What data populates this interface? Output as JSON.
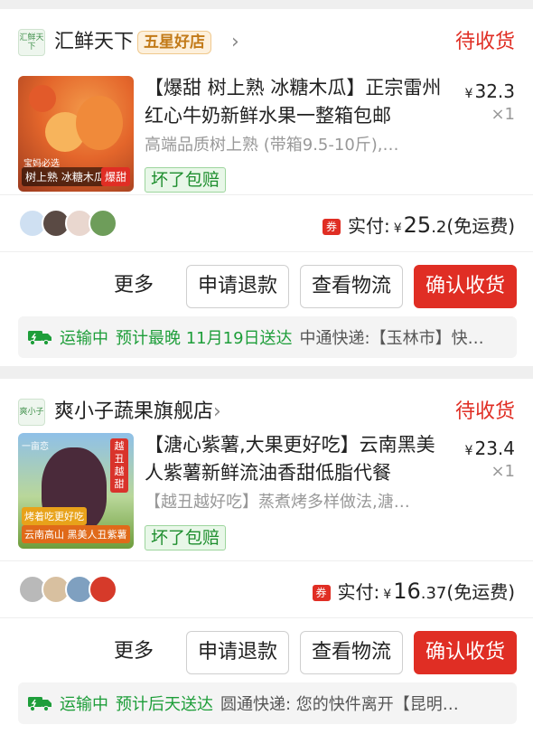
{
  "orders": [
    {
      "shop": {
        "logo_text": "汇鲜天下",
        "name": "汇鲜天下",
        "badge": "五星好店",
        "arrow": "›"
      },
      "status": "待收货",
      "product": {
        "image_caption": "树上熟 冰糖木瓜",
        "image_tag": "爆甜",
        "image_small": "宝妈必选",
        "title": "【爆甜 树上熟 冰糖木瓜】正宗雷州红心牛奶新鲜水果一整箱包邮",
        "spec": "高端品质树上熟 (带箱9.5-10斤),…",
        "guarantee": "坏了包赔",
        "price_symbol": "¥",
        "price": "32.3",
        "qty": "×1"
      },
      "payment": {
        "voucher": "券",
        "label": "实付:",
        "symbol": "¥",
        "amount_int": "25",
        "amount_dec": ".2",
        "note": "(免运费)"
      },
      "actions": {
        "more": "更多",
        "refund": "申请退款",
        "logistics": "查看物流",
        "confirm": "确认收货"
      },
      "shipping": {
        "status": "运输中",
        "eta": "预计最晚 11月19日送达",
        "carrier": "中通快递:【玉林市】快…"
      }
    },
    {
      "shop": {
        "logo_text": "爽小子",
        "name": "爽小子蔬果旗舰店",
        "arrow": "›"
      },
      "status": "待收货",
      "product": {
        "image_small": "一亩恋",
        "image_vtag": "越丑越甜",
        "image_caption": "烤着吃更好吃",
        "image_tag": "云南高山  黑美人丑紫薯",
        "title": "【溏心紫薯,大果更好吃】云南黑美人紫薯新鲜流油香甜低脂代餐",
        "spec": "【越丑越好吃】蒸煮烤多样做法,溏…",
        "guarantee": "坏了包赔",
        "price_symbol": "¥",
        "price": "23.4",
        "qty": "×1"
      },
      "payment": {
        "voucher": "券",
        "label": "实付:",
        "symbol": "¥",
        "amount_int": "16",
        "amount_dec": ".37",
        "note": "(免运费)"
      },
      "actions": {
        "more": "更多",
        "refund": "申请退款",
        "logistics": "查看物流",
        "confirm": "确认收货"
      },
      "shipping": {
        "status": "运输中",
        "eta": "预计后天送达",
        "carrier": "圆通快递: 您的快件离开【昆明…"
      }
    }
  ],
  "colors": {
    "accent_red": "#e02e24",
    "green": "#1e9e3a",
    "badge_gold": "#c27a18"
  },
  "icons": [
    "chevron-right-icon",
    "truck-icon",
    "voucher-icon"
  ]
}
